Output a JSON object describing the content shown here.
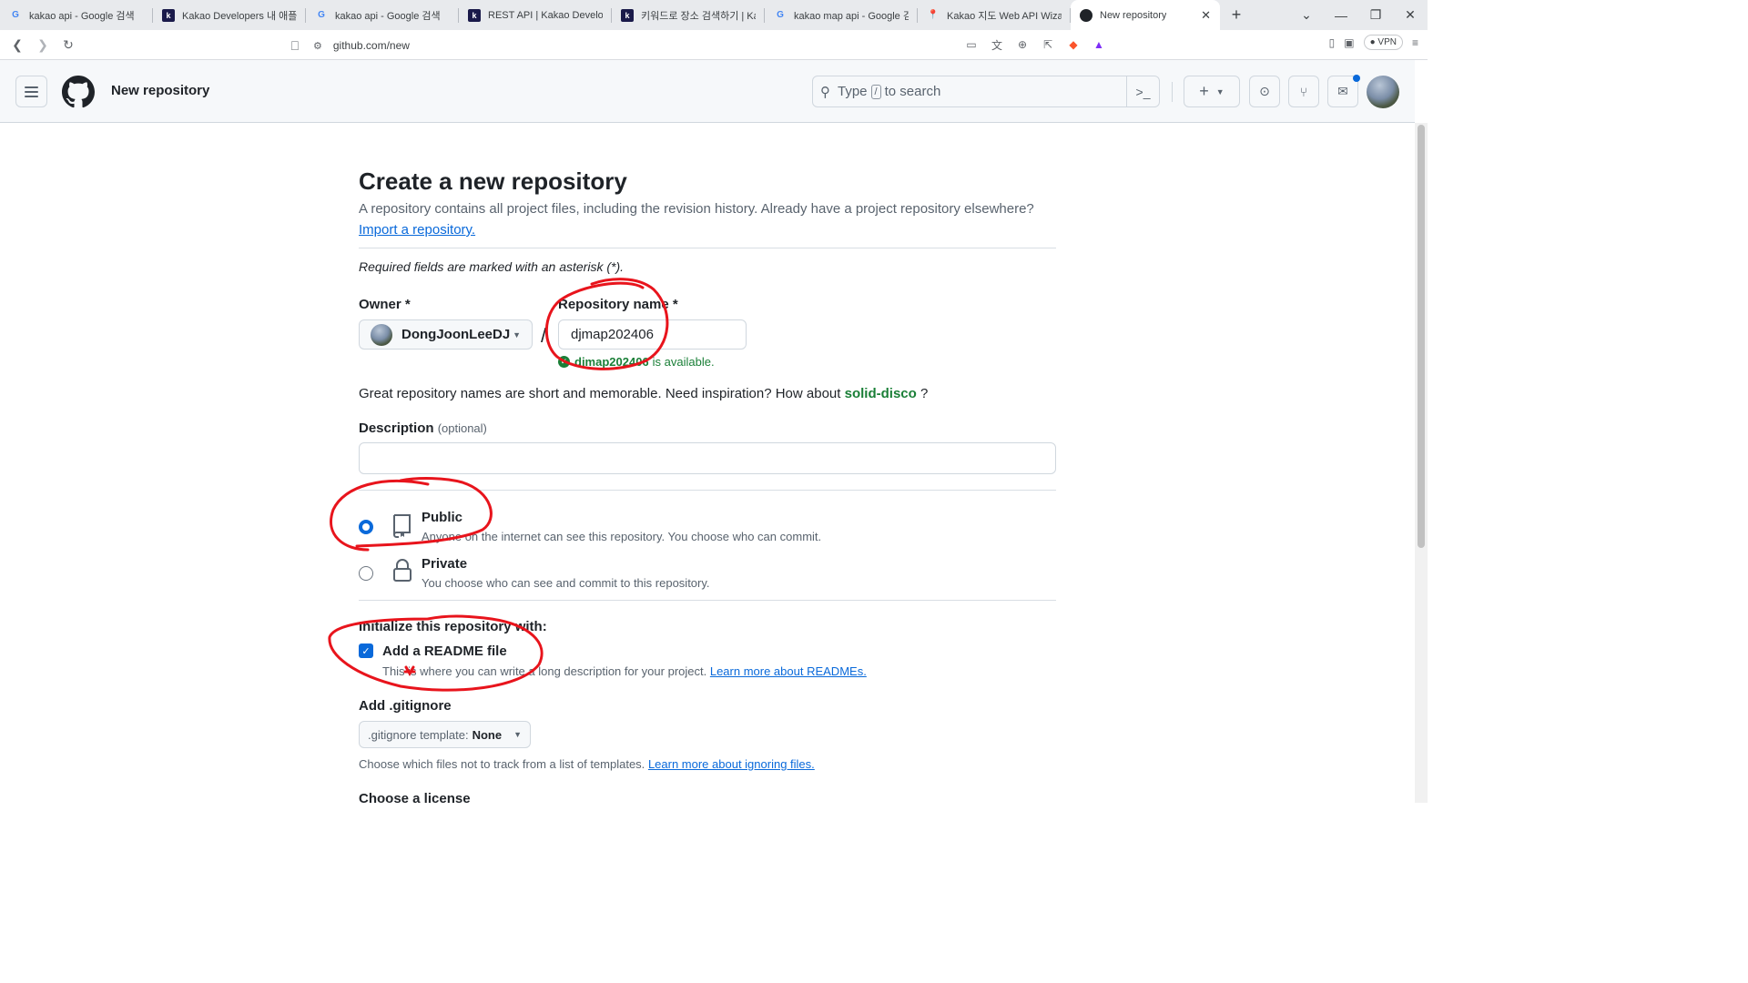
{
  "browser": {
    "tabs": [
      {
        "label": "kakao api - Google 검색",
        "icon": "google-icon",
        "active": false
      },
      {
        "label": "Kakao Developers 내 애플리케",
        "icon": "kakao-icon",
        "active": false
      },
      {
        "label": "kakao api - Google 검색",
        "icon": "google-icon",
        "active": false
      },
      {
        "label": "REST API | Kakao Developers",
        "icon": "kakao-icon",
        "active": false
      },
      {
        "label": "키워드로 장소 검색하기 | Kak",
        "icon": "kakao-icon",
        "active": false
      },
      {
        "label": "kakao map api - Google 검색",
        "icon": "google-icon",
        "active": false
      },
      {
        "label": "Kakao 지도 Web API Wizard",
        "icon": "map-pin-icon",
        "active": false
      },
      {
        "label": "New repository",
        "icon": "github-icon",
        "active": true
      }
    ],
    "url": "github.com/new",
    "vpn_label": "VPN"
  },
  "header": {
    "title": "New repository",
    "search_prefix": "Type",
    "search_key": "/",
    "search_suffix": "to search"
  },
  "page": {
    "heading": "Create a new repository",
    "subtitle": "A repository contains all project files, including the revision history. Already have a project repository elsewhere?",
    "import_link": "Import a repository.",
    "required_note": "Required fields are marked with an asterisk (*).",
    "owner_label": "Owner *",
    "owner_value": "DongJoonLeeDJ",
    "separator": "/",
    "repo_name_label": "Repository name *",
    "repo_name_value": "djmap202406",
    "availability_name": "djmap202406",
    "availability_text": "is available.",
    "inspiration_text": "Great repository names are short and memorable. Need inspiration? How about",
    "inspiration_suggestion": "solid-disco",
    "inspiration_end": "?",
    "description_label": "Description",
    "description_optional": "(optional)",
    "description_value": "",
    "visibility": {
      "selected": "Public",
      "public_title": "Public",
      "public_desc": "Anyone on the internet can see this repository. You choose who can commit.",
      "private_title": "Private",
      "private_desc": "You choose who can see and commit to this repository."
    },
    "init_title": "Initialize this repository with:",
    "readme_label": "Add a README file",
    "readme_checked": true,
    "readme_desc": "This is where you can write a long description for your project.",
    "readme_link": "Learn more about READMEs.",
    "gitignore_label": "Add .gitignore",
    "gitignore_prefix": ".gitignore template:",
    "gitignore_value": "None",
    "gitignore_desc": "Choose which files not to track from a list of templates.",
    "gitignore_link": "Learn more about ignoring files.",
    "license_label": "Choose a license"
  },
  "colors": {
    "accent": "#0969da",
    "success": "#1a7f37",
    "annotation": "#e8141c"
  }
}
